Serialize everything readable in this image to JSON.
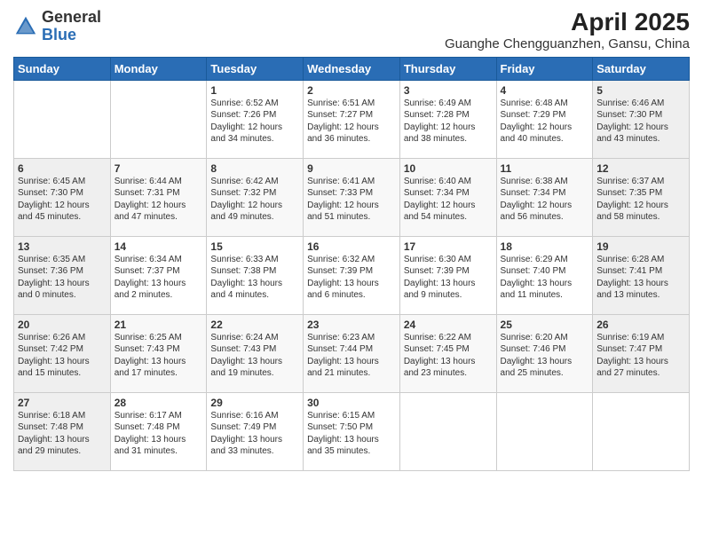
{
  "logo": {
    "general": "General",
    "blue": "Blue"
  },
  "title": "April 2025",
  "subtitle": "Guanghe Chengguanzhen, Gansu, China",
  "weekdays": [
    "Sunday",
    "Monday",
    "Tuesday",
    "Wednesday",
    "Thursday",
    "Friday",
    "Saturday"
  ],
  "weeks": [
    [
      {
        "day": "",
        "info": ""
      },
      {
        "day": "",
        "info": ""
      },
      {
        "day": "1",
        "info": "Sunrise: 6:52 AM\nSunset: 7:26 PM\nDaylight: 12 hours and 34 minutes."
      },
      {
        "day": "2",
        "info": "Sunrise: 6:51 AM\nSunset: 7:27 PM\nDaylight: 12 hours and 36 minutes."
      },
      {
        "day": "3",
        "info": "Sunrise: 6:49 AM\nSunset: 7:28 PM\nDaylight: 12 hours and 38 minutes."
      },
      {
        "day": "4",
        "info": "Sunrise: 6:48 AM\nSunset: 7:29 PM\nDaylight: 12 hours and 40 minutes."
      },
      {
        "day": "5",
        "info": "Sunrise: 6:46 AM\nSunset: 7:30 PM\nDaylight: 12 hours and 43 minutes."
      }
    ],
    [
      {
        "day": "6",
        "info": "Sunrise: 6:45 AM\nSunset: 7:30 PM\nDaylight: 12 hours and 45 minutes."
      },
      {
        "day": "7",
        "info": "Sunrise: 6:44 AM\nSunset: 7:31 PM\nDaylight: 12 hours and 47 minutes."
      },
      {
        "day": "8",
        "info": "Sunrise: 6:42 AM\nSunset: 7:32 PM\nDaylight: 12 hours and 49 minutes."
      },
      {
        "day": "9",
        "info": "Sunrise: 6:41 AM\nSunset: 7:33 PM\nDaylight: 12 hours and 51 minutes."
      },
      {
        "day": "10",
        "info": "Sunrise: 6:40 AM\nSunset: 7:34 PM\nDaylight: 12 hours and 54 minutes."
      },
      {
        "day": "11",
        "info": "Sunrise: 6:38 AM\nSunset: 7:34 PM\nDaylight: 12 hours and 56 minutes."
      },
      {
        "day": "12",
        "info": "Sunrise: 6:37 AM\nSunset: 7:35 PM\nDaylight: 12 hours and 58 minutes."
      }
    ],
    [
      {
        "day": "13",
        "info": "Sunrise: 6:35 AM\nSunset: 7:36 PM\nDaylight: 13 hours and 0 minutes."
      },
      {
        "day": "14",
        "info": "Sunrise: 6:34 AM\nSunset: 7:37 PM\nDaylight: 13 hours and 2 minutes."
      },
      {
        "day": "15",
        "info": "Sunrise: 6:33 AM\nSunset: 7:38 PM\nDaylight: 13 hours and 4 minutes."
      },
      {
        "day": "16",
        "info": "Sunrise: 6:32 AM\nSunset: 7:39 PM\nDaylight: 13 hours and 6 minutes."
      },
      {
        "day": "17",
        "info": "Sunrise: 6:30 AM\nSunset: 7:39 PM\nDaylight: 13 hours and 9 minutes."
      },
      {
        "day": "18",
        "info": "Sunrise: 6:29 AM\nSunset: 7:40 PM\nDaylight: 13 hours and 11 minutes."
      },
      {
        "day": "19",
        "info": "Sunrise: 6:28 AM\nSunset: 7:41 PM\nDaylight: 13 hours and 13 minutes."
      }
    ],
    [
      {
        "day": "20",
        "info": "Sunrise: 6:26 AM\nSunset: 7:42 PM\nDaylight: 13 hours and 15 minutes."
      },
      {
        "day": "21",
        "info": "Sunrise: 6:25 AM\nSunset: 7:43 PM\nDaylight: 13 hours and 17 minutes."
      },
      {
        "day": "22",
        "info": "Sunrise: 6:24 AM\nSunset: 7:43 PM\nDaylight: 13 hours and 19 minutes."
      },
      {
        "day": "23",
        "info": "Sunrise: 6:23 AM\nSunset: 7:44 PM\nDaylight: 13 hours and 21 minutes."
      },
      {
        "day": "24",
        "info": "Sunrise: 6:22 AM\nSunset: 7:45 PM\nDaylight: 13 hours and 23 minutes."
      },
      {
        "day": "25",
        "info": "Sunrise: 6:20 AM\nSunset: 7:46 PM\nDaylight: 13 hours and 25 minutes."
      },
      {
        "day": "26",
        "info": "Sunrise: 6:19 AM\nSunset: 7:47 PM\nDaylight: 13 hours and 27 minutes."
      }
    ],
    [
      {
        "day": "27",
        "info": "Sunrise: 6:18 AM\nSunset: 7:48 PM\nDaylight: 13 hours and 29 minutes."
      },
      {
        "day": "28",
        "info": "Sunrise: 6:17 AM\nSunset: 7:48 PM\nDaylight: 13 hours and 31 minutes."
      },
      {
        "day": "29",
        "info": "Sunrise: 6:16 AM\nSunset: 7:49 PM\nDaylight: 13 hours and 33 minutes."
      },
      {
        "day": "30",
        "info": "Sunrise: 6:15 AM\nSunset: 7:50 PM\nDaylight: 13 hours and 35 minutes."
      },
      {
        "day": "",
        "info": ""
      },
      {
        "day": "",
        "info": ""
      },
      {
        "day": "",
        "info": ""
      }
    ]
  ]
}
